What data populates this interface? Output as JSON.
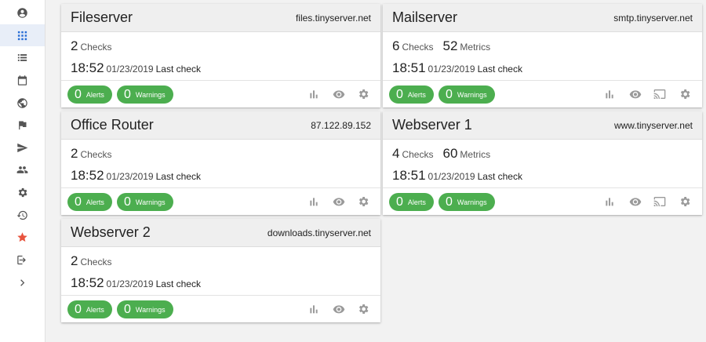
{
  "sidebar": {
    "items": [
      {
        "name": "account-circle-icon",
        "active": false
      },
      {
        "name": "grid-icon",
        "active": true
      },
      {
        "name": "list-icon",
        "active": false
      },
      {
        "name": "calendar-icon",
        "active": false
      },
      {
        "name": "globe-icon",
        "active": false
      },
      {
        "name": "flag-icon",
        "active": false
      },
      {
        "name": "send-icon",
        "active": false
      },
      {
        "name": "people-icon",
        "active": false
      },
      {
        "name": "gear-icon",
        "active": false
      },
      {
        "name": "history-icon",
        "active": false
      },
      {
        "name": "star-icon",
        "active": false
      },
      {
        "name": "login-icon",
        "active": false
      },
      {
        "name": "chevron-right-icon",
        "active": false
      }
    ]
  },
  "colors": {
    "green": "#4cae4f",
    "star": "#e8543e",
    "active_icon": "#2a6fd6",
    "icon": "#555555"
  },
  "servers": [
    {
      "name": "Fileserver",
      "host": "files.tinyserver.net",
      "checks": "2",
      "checks_label": "Checks",
      "time": "18:52",
      "date": "01/23/2019",
      "last_label": "Last check",
      "alerts": "0",
      "alerts_label": "Alerts",
      "warnings": "0",
      "warnings_label": "Warnings"
    },
    {
      "name": "Mailserver",
      "host": "smtp.tinyserver.net",
      "checks": "6",
      "checks_label": "Checks",
      "metrics": "52",
      "metrics_label": "Metrics",
      "time": "18:51",
      "date": "01/23/2019",
      "last_label": "Last check",
      "alerts": "0",
      "alerts_label": "Alerts",
      "warnings": "0",
      "warnings_label": "Warnings"
    },
    {
      "name": "Office Router",
      "host": "87.122.89.152",
      "checks": "2",
      "checks_label": "Checks",
      "time": "18:52",
      "date": "01/23/2019",
      "last_label": "Last check",
      "alerts": "0",
      "alerts_label": "Alerts",
      "warnings": "0",
      "warnings_label": "Warnings"
    },
    {
      "name": "Webserver 1",
      "host": "www.tinyserver.net",
      "checks": "4",
      "checks_label": "Checks",
      "metrics": "60",
      "metrics_label": "Metrics",
      "time": "18:51",
      "date": "01/23/2019",
      "last_label": "Last check",
      "alerts": "0",
      "alerts_label": "Alerts",
      "warnings": "0",
      "warnings_label": "Warnings"
    },
    {
      "name": "Webserver 2",
      "host": "downloads.tinyserver.net",
      "checks": "2",
      "checks_label": "Checks",
      "time": "18:52",
      "date": "01/23/2019",
      "last_label": "Last check",
      "alerts": "0",
      "alerts_label": "Alerts",
      "warnings": "0",
      "warnings_label": "Warnings"
    }
  ]
}
